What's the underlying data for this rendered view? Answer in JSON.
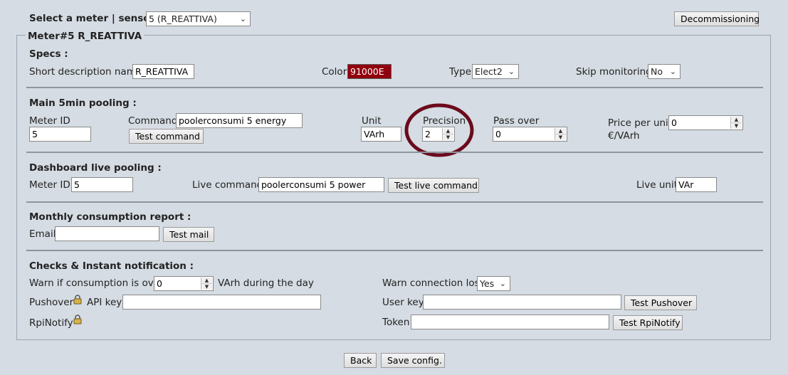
{
  "top": {
    "select_label": "Select a meter | sensor :",
    "select_value": "5 (R_REATTIVA)",
    "decommission_label": "Decommissioning"
  },
  "meter_title": "Meter#5 R_REATTIVA",
  "specs": {
    "heading": "Specs :",
    "short_desc_label": "Short description name",
    "short_desc_value": "R_REATTIVA",
    "color_label": "Color",
    "color_value": "91000E",
    "color_hex": "#91000E",
    "type_label": "Type",
    "type_value": "Elect2",
    "skip_label": "Skip monitoring",
    "skip_value": "No"
  },
  "main_pooling": {
    "heading": "Main 5min pooling :",
    "meter_id_label": "Meter ID",
    "meter_id_value": "5",
    "command_label": "Command",
    "command_value": "poolerconsumi 5 energy",
    "test_command_label": "Test command",
    "unit_label": "Unit",
    "unit_value": "VArh",
    "precision_label": "Precision",
    "precision_value": "2",
    "pass_over_label": "Pass over",
    "pass_over_value": "0",
    "price_label": "Price per unit",
    "price_value": "0",
    "price_unit": "€/VArh",
    "highlight_color": "#6b0a1c"
  },
  "dashboard": {
    "heading": "Dashboard live pooling :",
    "meter_id_label": "Meter ID",
    "meter_id_value": "5",
    "live_command_label": "Live command",
    "live_command_value": "poolerconsumi 5 power",
    "test_live_label": "Test live command",
    "live_unit_label": "Live unit",
    "live_unit_value": "VAr"
  },
  "monthly": {
    "heading": "Monthly consumption report :",
    "email_label": "Email",
    "email_value": "",
    "test_mail_label": "Test mail"
  },
  "checks": {
    "heading": "Checks & Instant notification :",
    "warn_label": "Warn if consumption is over",
    "warn_value": "0",
    "warn_suffix": "VArh during the day",
    "warn_conn_label": "Warn connection lost",
    "warn_conn_value": "Yes",
    "pushover_label": "Pushover",
    "api_key_label": "API key",
    "api_key_value": "",
    "user_key_label": "User key",
    "user_key_value": "",
    "test_pushover_label": "Test Pushover",
    "rpinotify_label": "RpiNotify",
    "token_label": "Token",
    "token_value": "",
    "test_rpinotify_label": "Test RpiNotify"
  },
  "footer": {
    "back_label": "Back",
    "save_label": "Save config."
  },
  "icons": {
    "lock": "lock-icon",
    "chevron": "chevron-down-icon",
    "spinner": "spinner-icon"
  }
}
